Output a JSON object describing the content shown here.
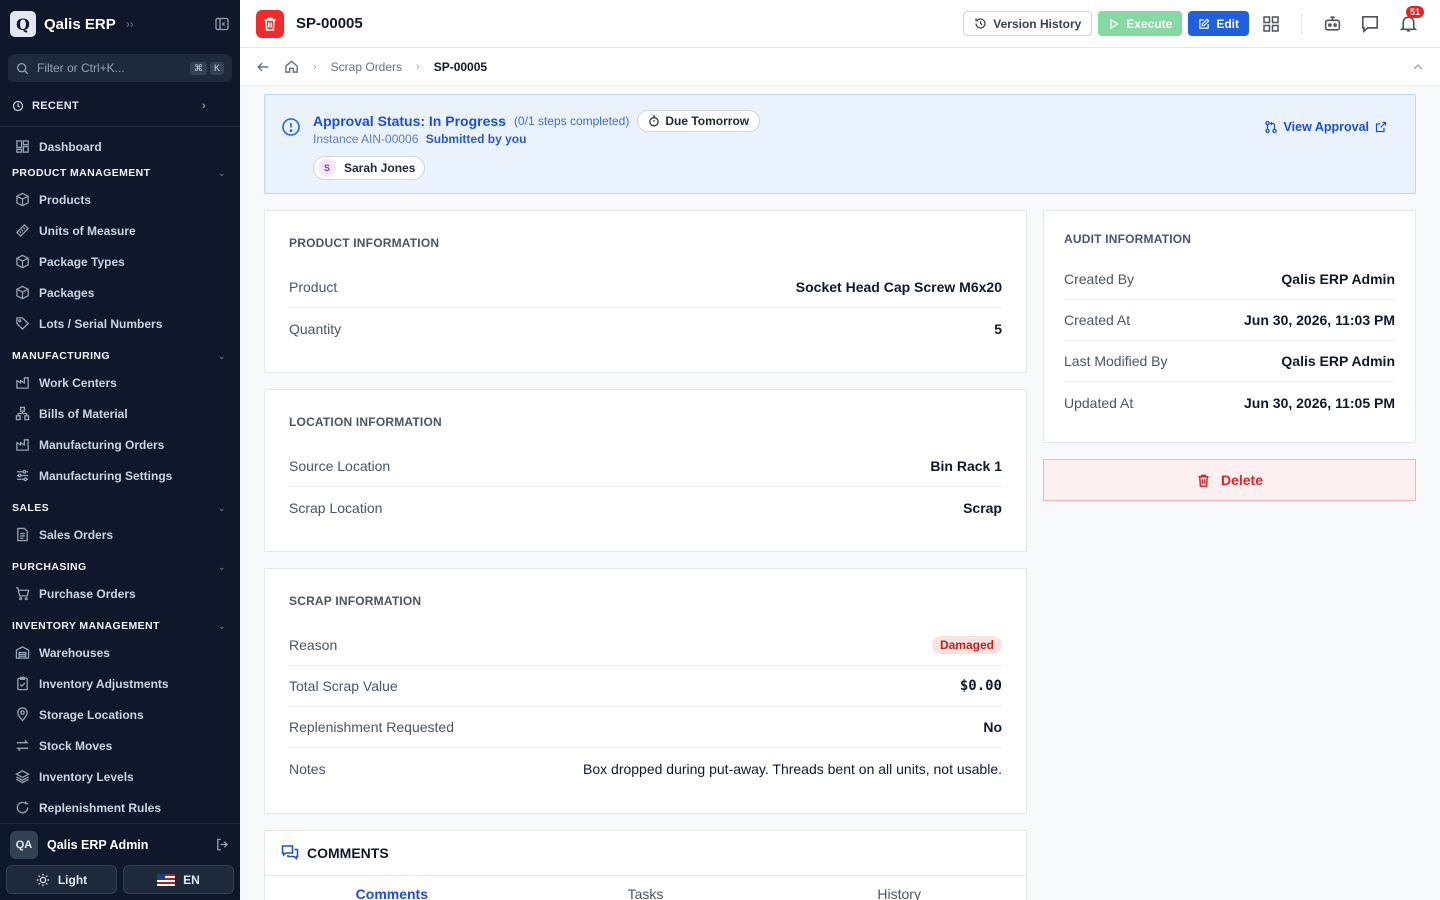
{
  "sidebar": {
    "app_name": "Qalis ERP",
    "logo_letter": "Q",
    "filter_placeholder": "Filter or Ctrl+K...",
    "kbd": [
      "⌘",
      "K"
    ],
    "recent_label": "RECENT",
    "dashboard": "Dashboard",
    "sections": {
      "product_management": "PRODUCT MANAGEMENT",
      "manufacturing": "MANUFACTURING",
      "sales": "SALES",
      "purchasing": "PURCHASING",
      "inventory_management": "INVENTORY MANAGEMENT"
    },
    "items": {
      "products": "Products",
      "units": "Units of Measure",
      "package_types": "Package Types",
      "packages": "Packages",
      "lots": "Lots / Serial Numbers",
      "work_centers": "Work Centers",
      "boms": "Bills of Material",
      "mfg_orders": "Manufacturing Orders",
      "mfg_settings": "Manufacturing Settings",
      "sales_orders": "Sales Orders",
      "purchase_orders": "Purchase Orders",
      "warehouses": "Warehouses",
      "inv_adjustments": "Inventory Adjustments",
      "storage_locations": "Storage Locations",
      "stock_moves": "Stock Moves",
      "inventory_levels": "Inventory Levels",
      "replenishment_rules": "Replenishment Rules"
    },
    "user": {
      "initials": "QA",
      "name": "Qalis ERP Admin"
    },
    "theme_label": "Light",
    "lang_label": "EN"
  },
  "topbar": {
    "title": "SP-00005",
    "version_history": "Version History",
    "execute": "Execute",
    "edit": "Edit",
    "notifications_count": "51"
  },
  "breadcrumb": {
    "parent": "Scrap Orders",
    "current": "SP-00005"
  },
  "approval": {
    "title": "Approval Status: In Progress",
    "steps": "(0/1 steps completed)",
    "due": "Due Tomorrow",
    "instance": "Instance AIN-00006",
    "submitted": "Submitted by you",
    "approver_initial": "S",
    "approver": "Sarah Jones",
    "view_link": "View Approval"
  },
  "product_info": {
    "heading": "PRODUCT INFORMATION",
    "product_label": "Product",
    "product_value": "Socket Head Cap Screw M6x20",
    "quantity_label": "Quantity",
    "quantity_value": "5"
  },
  "location_info": {
    "heading": "LOCATION INFORMATION",
    "source_label": "Source Location",
    "source_value": "Bin Rack 1",
    "scrap_label": "Scrap Location",
    "scrap_value": "Scrap"
  },
  "scrap_info": {
    "heading": "SCRAP INFORMATION",
    "reason_label": "Reason",
    "reason_value": "Damaged",
    "value_label": "Total Scrap Value",
    "value_value": "$0.00",
    "replen_label": "Replenishment Requested",
    "replen_value": "No",
    "notes_label": "Notes",
    "notes_value": "Box dropped during put-away. Threads bent on all units, not usable."
  },
  "audit_info": {
    "heading": "AUDIT INFORMATION",
    "created_by_label": "Created By",
    "created_by_value": "Qalis ERP Admin",
    "created_at_label": "Created At",
    "created_at_value": "Jun 30, 2026, 11:03 PM",
    "modified_by_label": "Last Modified By",
    "modified_by_value": "Qalis ERP Admin",
    "updated_at_label": "Updated At",
    "updated_at_value": "Jun 30, 2026, 11:05 PM"
  },
  "delete_label": "Delete",
  "comments": {
    "heading": "COMMENTS",
    "tabs": [
      "Comments",
      "Tasks",
      "History"
    ]
  }
}
